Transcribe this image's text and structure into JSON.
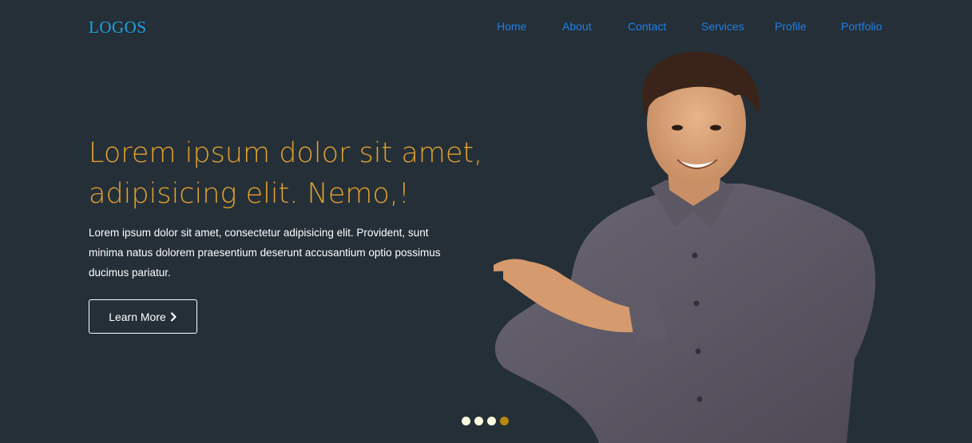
{
  "brand": {
    "logo_text": "LOGOS"
  },
  "nav": {
    "items": [
      {
        "label": "Home"
      },
      {
        "label": "About"
      },
      {
        "label": "Contact"
      },
      {
        "label": "Services"
      },
      {
        "label": "Profile"
      },
      {
        "label": "Portfolio"
      }
    ]
  },
  "hero": {
    "title": "Lorem ipsum dolor sit amet, adipisicing elit. Nemo,!",
    "subtitle": "Lorem ipsum dolor sit amet, consectetur adipisicing elit. Provident, sunt minima natus dolorem praesentium deserunt accusantium optio possimus ducimus pariatur.",
    "cta_label": "Learn More",
    "cta_icon": "chevron-right-icon"
  },
  "carousel": {
    "slide_count": 4,
    "active_index": 4
  },
  "colors": {
    "background": "#252f38",
    "logo": "#1ca2de",
    "nav_link": "#1d7fe8",
    "title": "#e0a12e",
    "dot_inactive": "#fffbe0",
    "dot_active": "#b8860b"
  }
}
